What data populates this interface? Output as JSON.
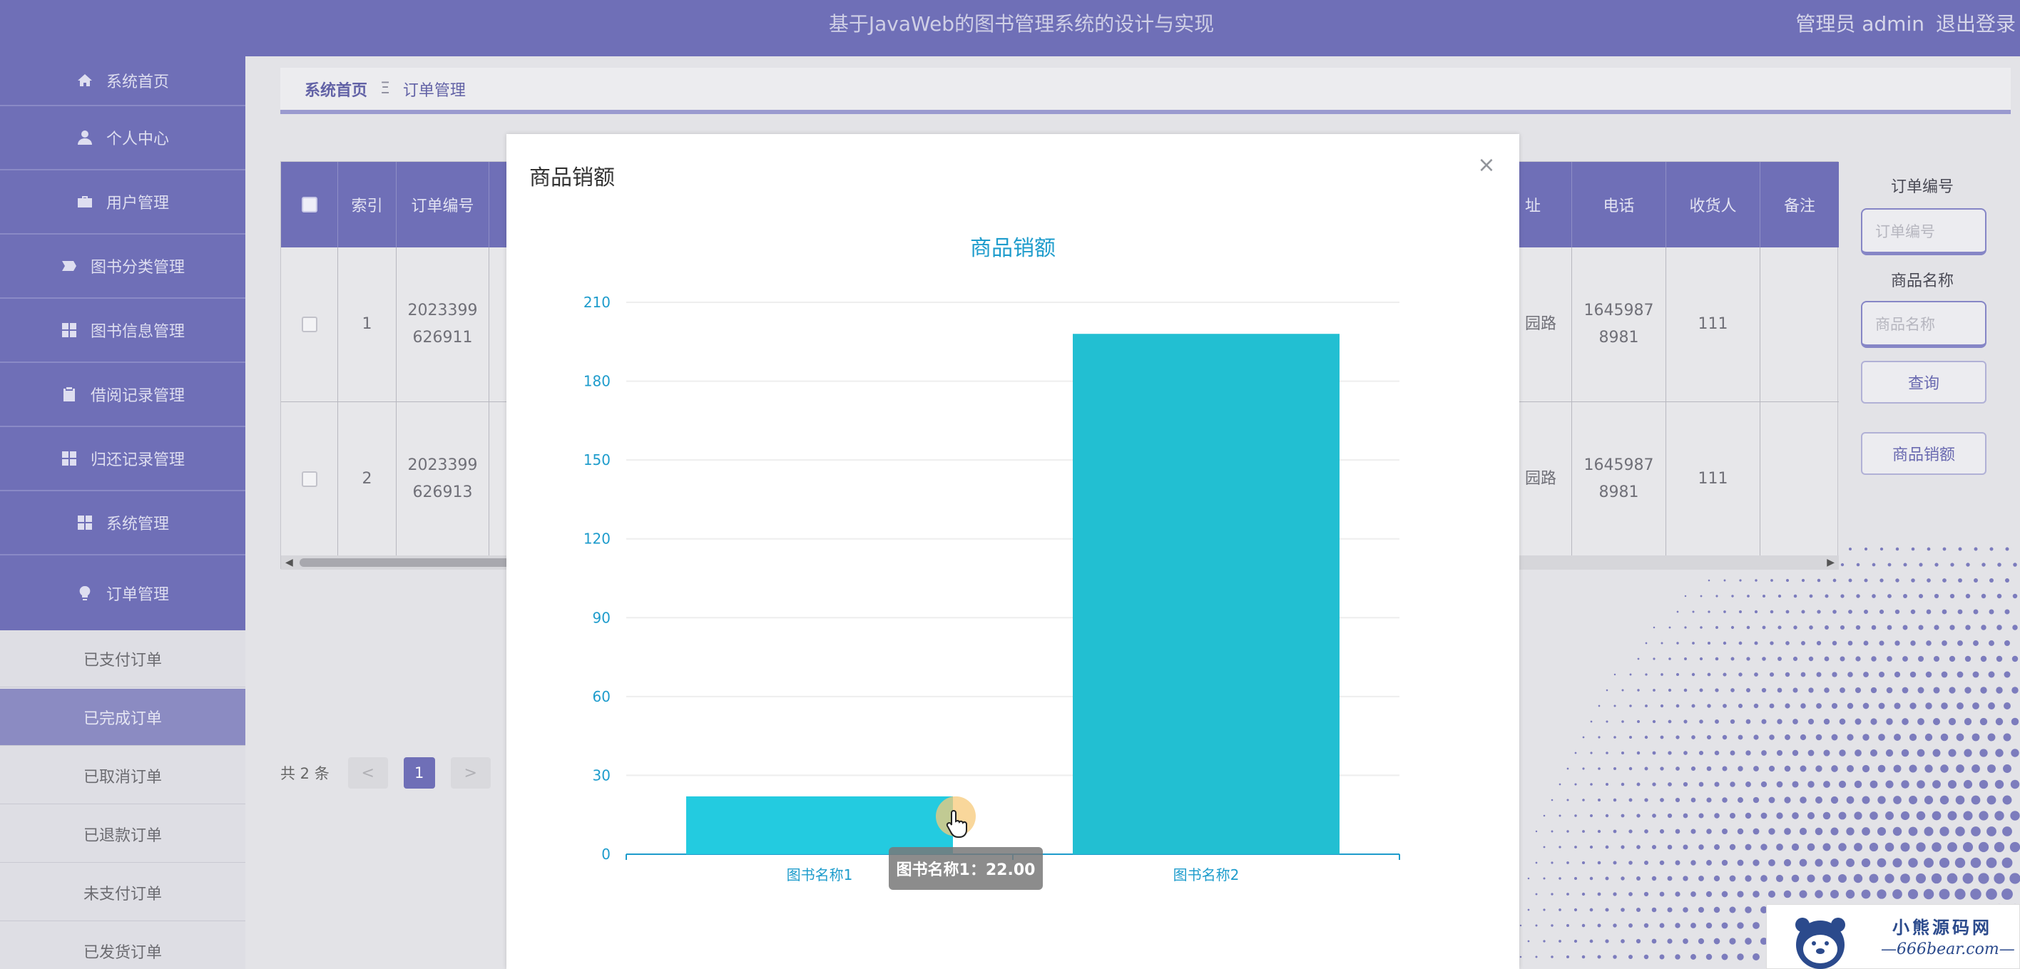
{
  "header": {
    "title": "基于JavaWeb的图书管理系统的设计与实现",
    "user_label": "管理员 admin",
    "logout_label": "退出登录"
  },
  "sidebar": {
    "items": [
      {
        "label": "系统首页",
        "icon": "home-icon"
      },
      {
        "label": "个人中心",
        "icon": "user-icon"
      },
      {
        "label": "用户管理",
        "icon": "briefcase-icon"
      },
      {
        "label": "图书分类管理",
        "icon": "tag-icon"
      },
      {
        "label": "图书信息管理",
        "icon": "grid-icon"
      },
      {
        "label": "借阅记录管理",
        "icon": "clipboard-icon"
      },
      {
        "label": "归还记录管理",
        "icon": "grid-icon"
      },
      {
        "label": "系统管理",
        "icon": "grid-icon"
      },
      {
        "label": "订单管理",
        "icon": "bulb-icon"
      }
    ],
    "submenu": [
      {
        "label": "已支付订单"
      },
      {
        "label": "已完成订单"
      },
      {
        "label": "已取消订单"
      },
      {
        "label": "已退款订单"
      },
      {
        "label": "未支付订单"
      },
      {
        "label": "已发货订单"
      }
    ]
  },
  "breadcrumb": {
    "home": "系统首页",
    "separator": "Ξ",
    "current": "订单管理"
  },
  "table": {
    "headers": [
      "索引",
      "订单编号",
      "址",
      "电话",
      "收货人",
      "备注"
    ],
    "rows": [
      {
        "index": "1",
        "order_no_1": "2023399",
        "order_no_2": "626911",
        "addr": "园路",
        "phone_1": "1645987",
        "phone_2": "8981",
        "receiver": "111",
        "note": ""
      },
      {
        "index": "2",
        "order_no_1": "2023399",
        "order_no_2": "626913",
        "addr": "园路",
        "phone_1": "1645987",
        "phone_2": "8981",
        "receiver": "111",
        "note": ""
      }
    ]
  },
  "search": {
    "order_no_label": "订单编号",
    "order_no_placeholder": "订单编号",
    "product_label": "商品名称",
    "product_placeholder": "商品名称",
    "query_label": "查询",
    "sales_label": "商品销额"
  },
  "pagination": {
    "total_label": "共 2 条",
    "prev": "<",
    "current": "1",
    "next": ">"
  },
  "modal": {
    "title": "商品销额",
    "close": "×",
    "tooltip": "图书名称1：22.00"
  },
  "chart_data": {
    "type": "bar",
    "title": "商品销额",
    "categories": [
      "图书名称1",
      "图书名称2"
    ],
    "values": [
      22,
      198
    ],
    "ylim": [
      0,
      210
    ],
    "yticks": [
      0,
      30,
      60,
      90,
      120,
      150,
      180,
      210
    ],
    "grid": true,
    "colors": {
      "bar_1": "#23cbe0",
      "bar_2": "#22bfd2",
      "title": "#1e9ccc",
      "axis": "#1e9ccc"
    }
  },
  "watermark": {
    "name": "小熊源码网",
    "url": "—666bear.com—"
  }
}
